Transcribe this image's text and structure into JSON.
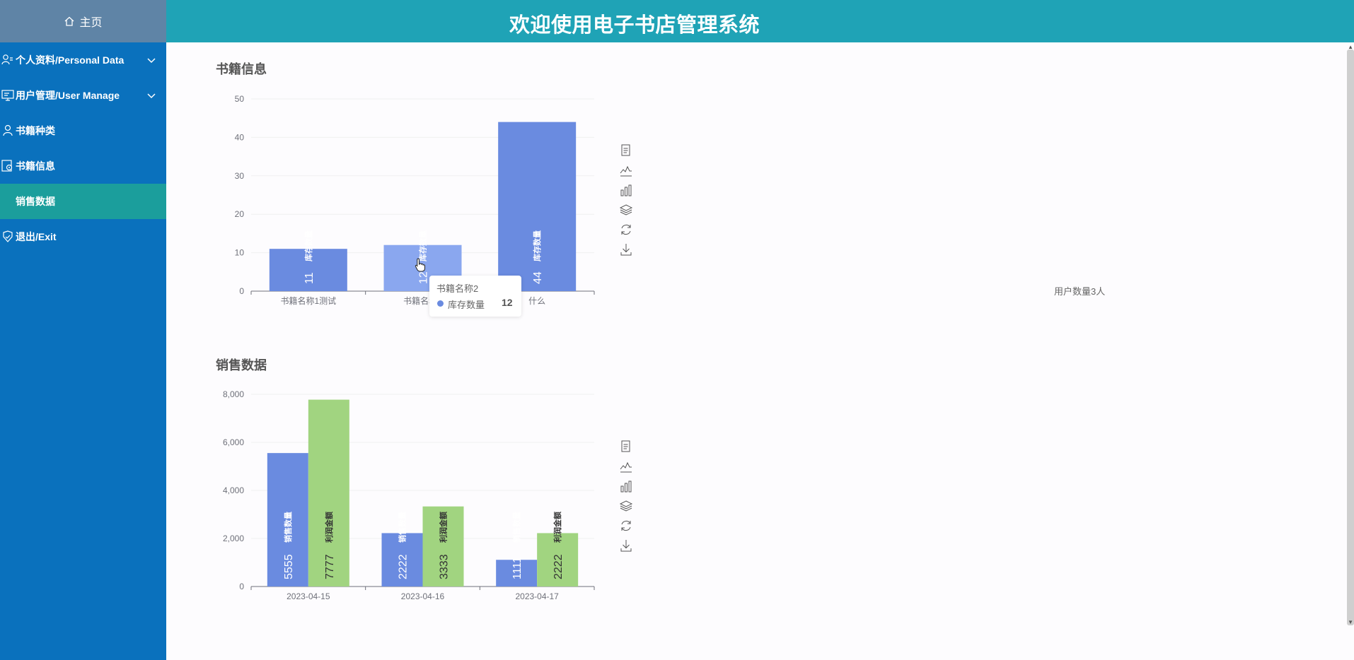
{
  "sidebar": {
    "home_label": "主页",
    "items": [
      {
        "label": "个人资料/Personal Data"
      },
      {
        "label": "用户管理/User Manage"
      },
      {
        "label": "书籍种类"
      },
      {
        "label": "书籍信息"
      },
      {
        "label": "销售数据"
      },
      {
        "label": "退出/Exit"
      }
    ]
  },
  "header": {
    "title": "欢迎使用电子书店管理系统"
  },
  "main": {
    "chart1_title": "书籍信息",
    "chart2_title": "销售数据",
    "user_count": "用户数量3人"
  },
  "tooltip": {
    "title": "书籍名称2",
    "series": "库存数量",
    "value": "12"
  },
  "chart_data": [
    {
      "type": "bar",
      "title": "书籍信息",
      "categories": [
        "书籍名称1测试",
        "书籍名称2",
        "什么"
      ],
      "series": [
        {
          "name": "库存数量",
          "values": [
            11,
            12,
            44
          ]
        }
      ],
      "ylim": [
        0,
        50
      ],
      "yticks": [
        0,
        10,
        20,
        30,
        40,
        50
      ],
      "colors": [
        "#6a8be0"
      ],
      "hover_color": "#8aa7ef",
      "grid": true
    },
    {
      "type": "bar",
      "title": "销售数据",
      "categories": [
        "2023-04-15",
        "2023-04-16",
        "2023-04-17"
      ],
      "series": [
        {
          "name": "销售数量",
          "values": [
            5555,
            2222,
            1111
          ]
        },
        {
          "name": "利润金额",
          "values": [
            7777,
            3333,
            2222
          ]
        }
      ],
      "ylim": [
        0,
        8000
      ],
      "yticks": [
        0,
        2000,
        4000,
        6000,
        8000
      ],
      "ytick_labels": [
        "0",
        "2,000",
        "4,000",
        "6,000",
        "8,000"
      ],
      "colors": [
        "#6a8be0",
        "#a1d480"
      ],
      "grid": true
    }
  ],
  "toolbox": [
    "data-view-icon",
    "line-chart-icon",
    "bar-chart-icon",
    "stack-icon",
    "restore-icon",
    "download-icon"
  ]
}
